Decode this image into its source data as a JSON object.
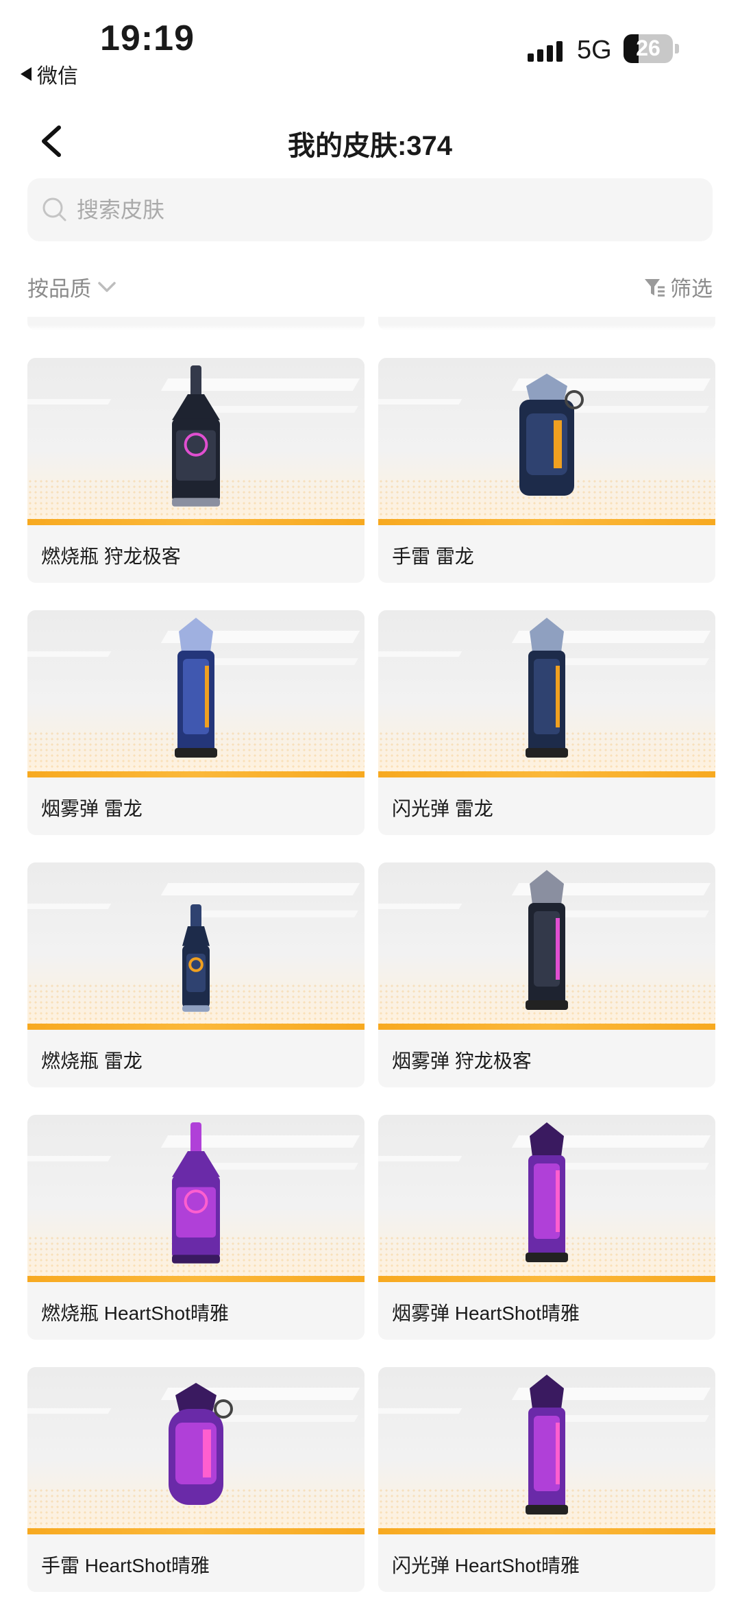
{
  "status_bar": {
    "time": "19:19",
    "back_app": "微信",
    "network": "5G",
    "battery": "26"
  },
  "header": {
    "title": "我的皮肤:374"
  },
  "search": {
    "placeholder": "搜索皮肤",
    "value": ""
  },
  "toolbar": {
    "sort_label": "按品质",
    "filter_label": "筛选"
  },
  "colors": {
    "rarity_bar": "#f7a920",
    "card_bg": "#f5f5f5"
  },
  "skins": [
    {
      "name": "燃烧瓶 狩龙极客",
      "shape": "molotov",
      "theme": "dark-pink"
    },
    {
      "name": "手雷 雷龙",
      "shape": "grenade",
      "theme": "navy-orange"
    },
    {
      "name": "烟雾弹 雷龙",
      "shape": "smoke",
      "theme": "blue-orange"
    },
    {
      "name": "闪光弹 雷龙",
      "shape": "flash",
      "theme": "navy-orange"
    },
    {
      "name": "燃烧瓶 雷龙",
      "shape": "molotov-slim",
      "theme": "navy-orange"
    },
    {
      "name": "烟雾弹 狩龙极客",
      "shape": "smoke",
      "theme": "dark-pink"
    },
    {
      "name": "燃烧瓶 HeartShot晴雅",
      "shape": "molotov",
      "theme": "purple-pink"
    },
    {
      "name": "烟雾弹 HeartShot晴雅",
      "shape": "smoke",
      "theme": "purple-pink"
    },
    {
      "name": "手雷 HeartShot晴雅",
      "shape": "grenade-round",
      "theme": "purple-pink"
    },
    {
      "name": "闪光弹 HeartShot晴雅",
      "shape": "flash",
      "theme": "purple-pink"
    }
  ]
}
